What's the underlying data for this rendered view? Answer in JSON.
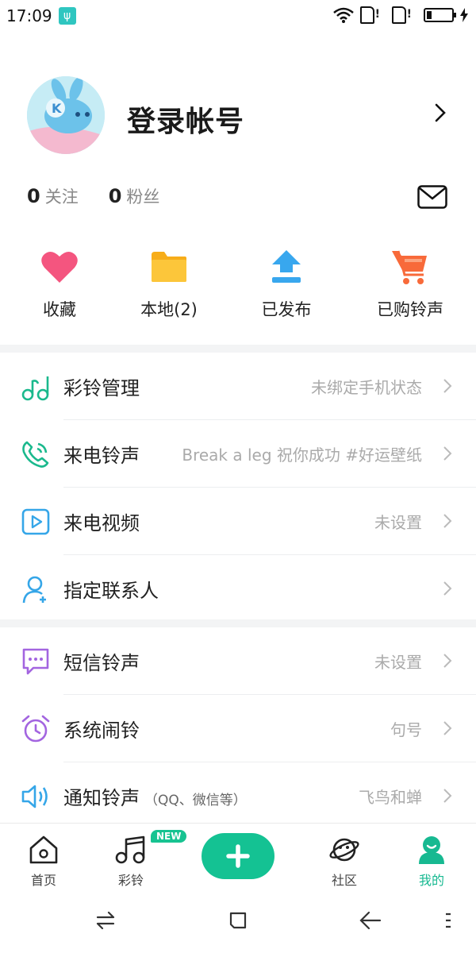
{
  "status_bar": {
    "time": "17:09",
    "battery_percent": 20
  },
  "profile": {
    "login_label": "登录帐号"
  },
  "stats": [
    {
      "value": "0",
      "label": "关注"
    },
    {
      "value": "0",
      "label": "粉丝"
    }
  ],
  "quick_actions": [
    {
      "label": "收藏",
      "icon": "heart-icon"
    },
    {
      "label": "本地(2)",
      "icon": "folder-icon"
    },
    {
      "label": "已发布",
      "icon": "upload-icon"
    },
    {
      "label": "已购铃声",
      "icon": "cart-icon"
    }
  ],
  "menu_group_1": [
    {
      "label": "彩铃管理",
      "value": "未绑定手机状态",
      "icon": "music-notes-icon"
    },
    {
      "label": "来电铃声",
      "value": "Break a leg 祝你成功 #好运壁纸",
      "icon": "phone-ring-icon"
    },
    {
      "label": "来电视频",
      "value": "未设置",
      "icon": "video-play-icon"
    },
    {
      "label": "指定联系人",
      "value": "",
      "icon": "add-contact-icon"
    }
  ],
  "menu_group_2": [
    {
      "label": "短信铃声",
      "value": "未设置",
      "icon": "message-icon"
    },
    {
      "label": "系统闹铃",
      "value": "句号",
      "icon": "alarm-clock-icon"
    },
    {
      "label": "通知铃声",
      "sublabel": "（QQ、微信等）",
      "value": "飞鸟和蝉",
      "icon": "speaker-icon"
    }
  ],
  "bottom_nav": {
    "items": [
      {
        "label": "首页",
        "icon": "home-icon"
      },
      {
        "label": "彩铃",
        "icon": "music-icon"
      },
      {
        "label": "社区",
        "icon": "planet-icon"
      },
      {
        "label": "我的",
        "icon": "user-icon"
      }
    ],
    "new_badge": "NEW",
    "active": "我的"
  },
  "colors": {
    "accent": "#14c293",
    "heart": "#f4557f",
    "folder": "#fbbf2d",
    "upload": "#38a7ee",
    "cart": "#f86a3a"
  }
}
